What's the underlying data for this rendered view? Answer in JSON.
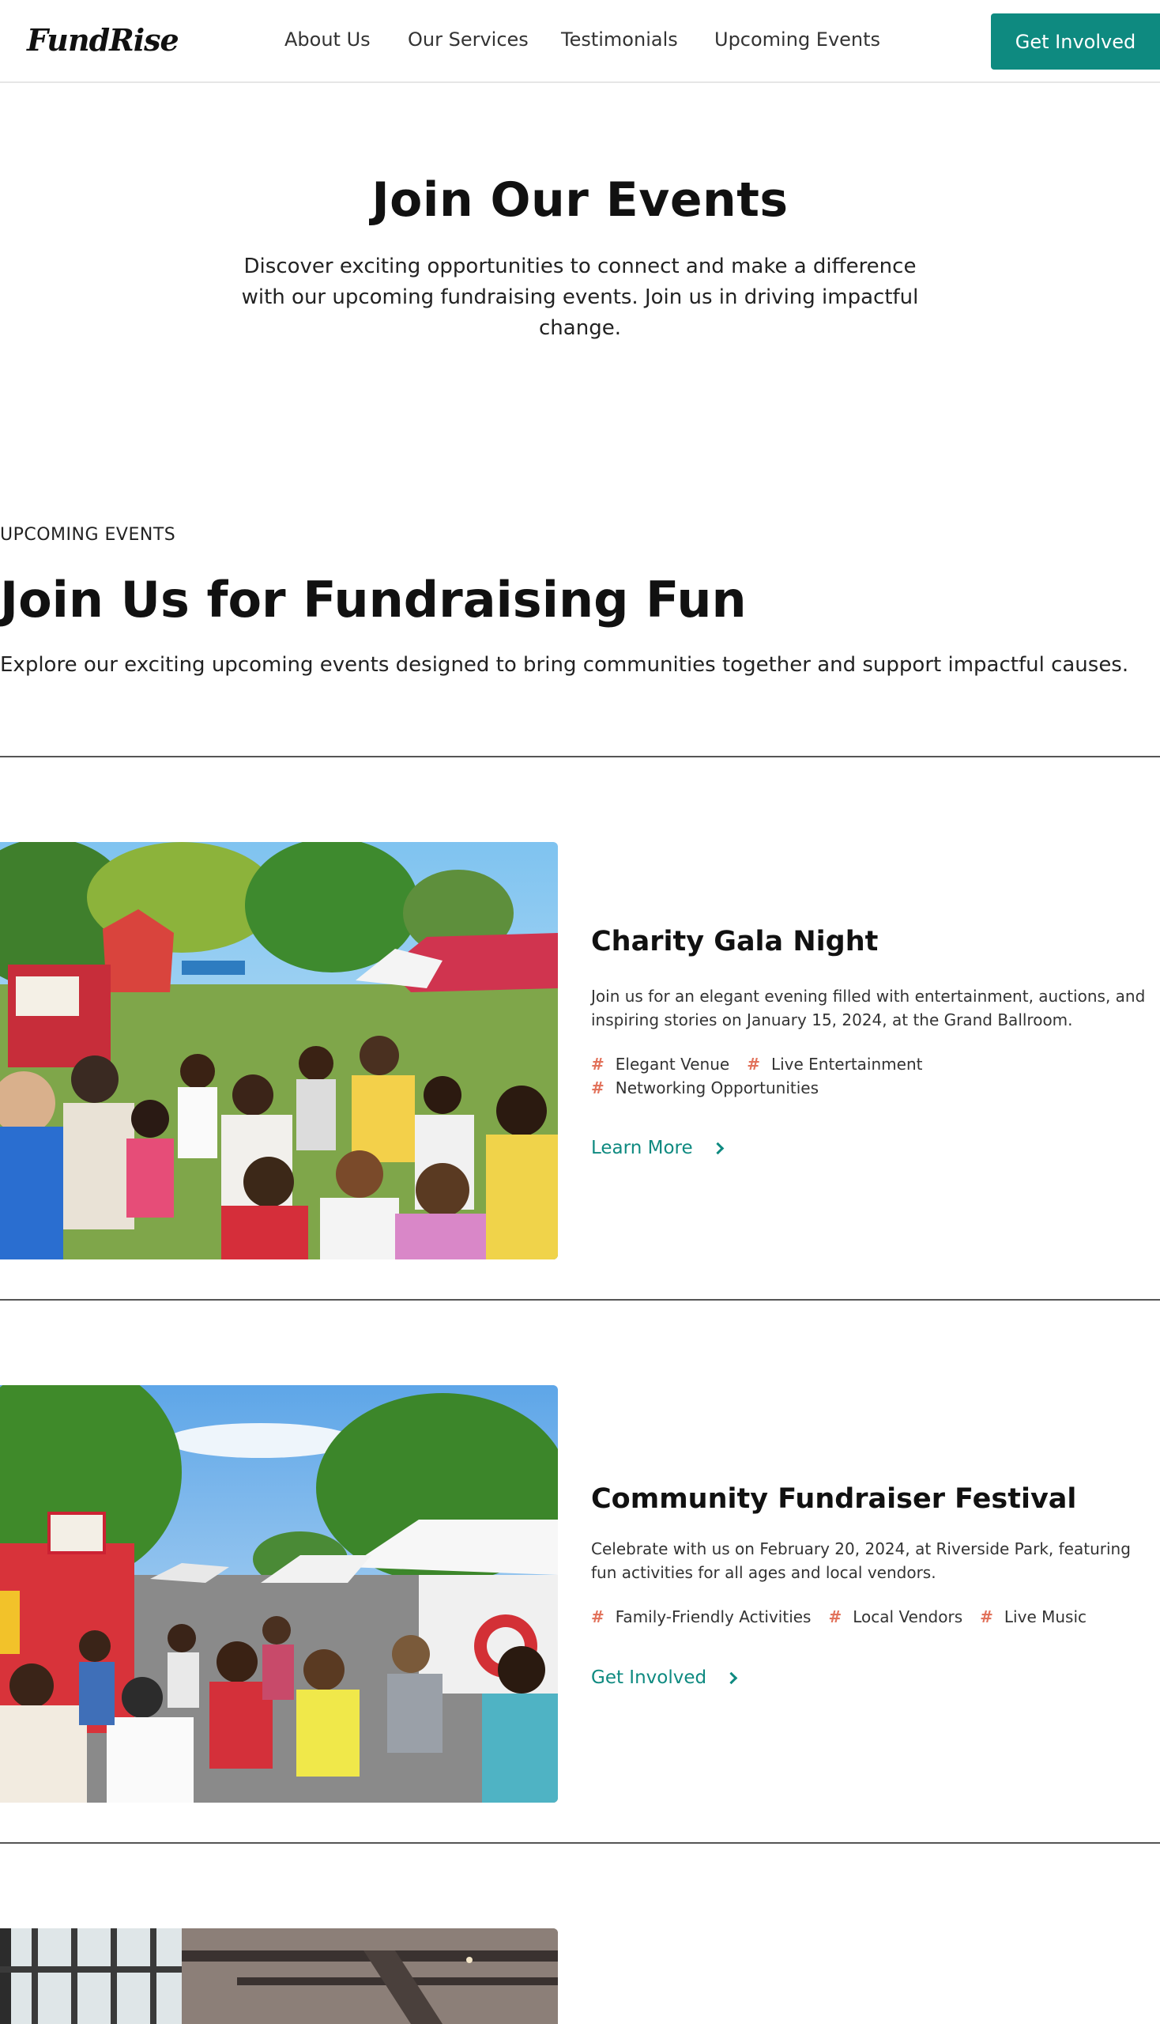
{
  "header": {
    "logo": "FundRise",
    "nav": [
      "About Us",
      "Our Services",
      "Testimonials",
      "Upcoming Events"
    ],
    "cta": "Get Involved"
  },
  "hero": {
    "title": "Join Our Events",
    "subtitle": "Discover exciting opportunities to connect and make a difference with our upcoming fundraising events. Join us in driving impactful change."
  },
  "section": {
    "eyebrow": "UPCOMING EVENTS",
    "title": "Join Us for Fundraising Fun",
    "description": "Explore our exciting upcoming events designed to bring communities together and support impactful causes."
  },
  "events": [
    {
      "title": "Charity Gala Night",
      "description": "Join us for an elegant evening filled with entertainment, auctions, and inspiring stories on January 15, 2024, at the Grand Ballroom.",
      "tags": [
        "Elegant Venue",
        "Live Entertainment",
        "Networking Opportunities"
      ],
      "link": "Learn More",
      "image_icon": "outdoor-fair-photo"
    },
    {
      "title": "Community Fundraiser Festival",
      "description": "Celebrate with us on February 20, 2024, at Riverside Park, featuring fun activities for all ages and local vendors.",
      "tags": [
        "Family-Friendly Activities",
        "Local Vendors",
        "Live Music"
      ],
      "link": "Get Involved",
      "image_icon": "street-festival-photo"
    },
    {
      "image_icon": "indoor-hall-photo"
    }
  ],
  "colors": {
    "accent": "#0e8a80",
    "tag_hash": "#e2725b",
    "divider": "#555555"
  }
}
